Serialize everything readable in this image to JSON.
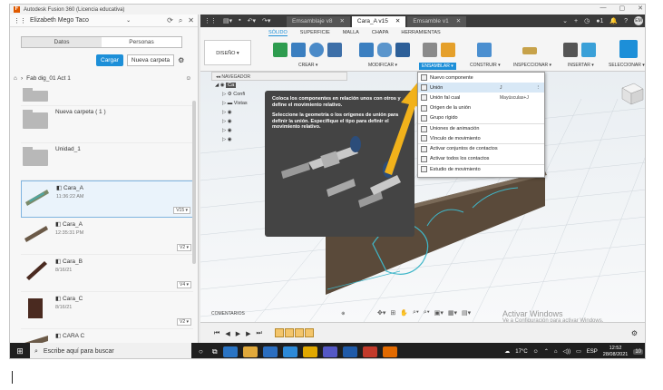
{
  "window": {
    "title": "Autodesk Fusion 360 (Licencia educativa)",
    "controls": [
      "—",
      "▢",
      "✕"
    ]
  },
  "data_panel": {
    "user": "Elizabeth Mego Taco",
    "tabs": [
      "Datos",
      "Personas"
    ],
    "upload_label": "Cargar",
    "new_folder_label": "Nueva carpeta",
    "breadcrumb": "Fab dig_01 Act 1",
    "items": [
      {
        "type": "folder",
        "name": "",
        "date": "",
        "version": ""
      },
      {
        "type": "folder",
        "name": "Nueva carpeta ( 1 )",
        "date": "",
        "version": ""
      },
      {
        "type": "folder",
        "name": "Unidad_1",
        "date": "",
        "version": ""
      },
      {
        "type": "file",
        "name": "Cara_A",
        "date": "11:36:22 AM",
        "version": "V15 ▾"
      },
      {
        "type": "file",
        "name": "Cara_A",
        "date": "12:35:31 PM",
        "version": "V2 ▾"
      },
      {
        "type": "file",
        "name": "Cara_B",
        "date": "8/16/21",
        "version": "V4 ▾"
      },
      {
        "type": "file",
        "name": "Cara_C",
        "date": "8/16/21",
        "version": "V2 ▾"
      },
      {
        "type": "file",
        "name": "CARA C",
        "date": "",
        "version": ""
      }
    ]
  },
  "doc_tabs": [
    {
      "label": "Emsamblaje v8",
      "active": false
    },
    {
      "label": "Cara_A v15",
      "active": true
    },
    {
      "label": "Emsamble v1",
      "active": false
    }
  ],
  "user_initials": "EM",
  "ribbon": {
    "tabs": [
      "SÓLIDO",
      "SUPERFICIE",
      "MALLA",
      "CHAPA",
      "HERRAMIENTAS"
    ],
    "active_tab": "SÓLIDO",
    "design_label": "DISEÑO ▾",
    "groups": [
      "CREAR ▾",
      "MODIFICAR ▾",
      "ENSAMBLAR ▾",
      "CONSTRUIR ▾",
      "INSPECCIONAR ▾",
      "INSERTAR ▾",
      "SELECCIONAR ▾"
    ]
  },
  "browser": {
    "title": "NAVEGADOR",
    "root": "Ca",
    "rows": [
      "Confi",
      "Vistas",
      "",
      "",
      "",
      ""
    ]
  },
  "tooltip": {
    "line1": "Coloca los componentes en relación unos con otros y define el movimiento relativo.",
    "line2": "Seleccione la geometría o los orígenes de unión para definir la unión. Especifique el tipo para definir el movimiento relativo."
  },
  "assemble_menu": [
    {
      "label": "Nuevo componente",
      "shortcut": "",
      "highlight": false
    },
    {
      "label": "Unión",
      "shortcut": "J",
      "highlight": true
    },
    {
      "label": "Unión fal cual",
      "shortcut": "Mayúsculas+J",
      "highlight": false
    },
    {
      "label": "Origen de la unión",
      "shortcut": "",
      "highlight": false
    },
    {
      "label": "Grupo rígido",
      "shortcut": "",
      "highlight": false
    },
    {
      "label": "Uniones de animación",
      "shortcut": "",
      "highlight": false
    },
    {
      "label": "Vínculo de movimiento",
      "shortcut": "",
      "highlight": false
    },
    {
      "label": "Activar conjuntos de contactos",
      "shortcut": "",
      "highlight": false
    },
    {
      "label": "Activar todos los contactos",
      "shortcut": "",
      "highlight": false
    },
    {
      "label": "Estudio de movimiento",
      "shortcut": "",
      "highlight": false
    }
  ],
  "comments_label": "COMENTARIOS",
  "watermark": {
    "line1": "Activar Windows",
    "line2": "Ve a Configuración para activar Windows."
  },
  "taskbar": {
    "search_placeholder": "Escribe aquí para buscar",
    "temperature": "17°C",
    "language": "ESP",
    "time": "12:52",
    "date": "28/08/2021",
    "notification_count": "10"
  }
}
